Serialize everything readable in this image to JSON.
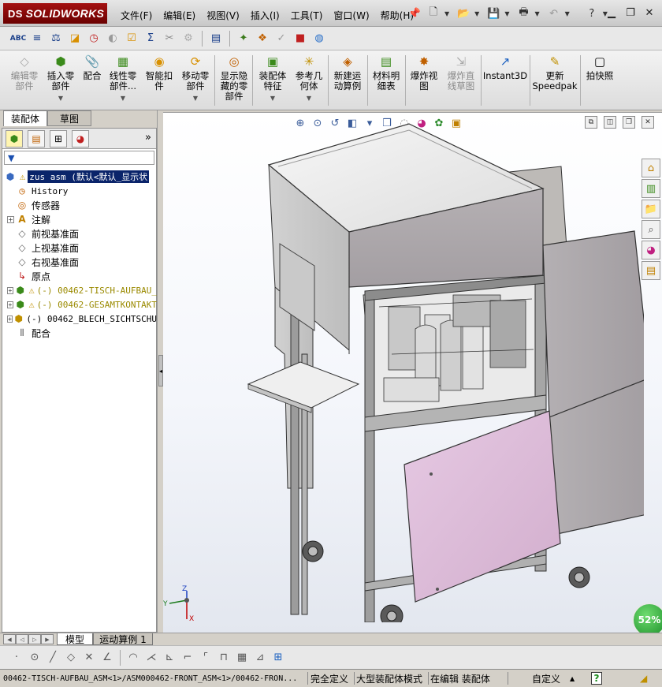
{
  "app": {
    "name": "SOLIDWORKS",
    "logo_prefix": "DS",
    "menu": [
      "文件(F)",
      "编辑(E)",
      "视图(V)",
      "插入(I)",
      "工具(T)",
      "窗口(W)",
      "帮助(H)"
    ],
    "title_icons": [
      "pin-icon",
      "new-icon",
      "open-icon",
      "save-icon",
      "print-icon",
      "undo-icon",
      "help-icon"
    ],
    "window_controls": [
      "minimize-icon",
      "restore-icon",
      "close-icon"
    ]
  },
  "sketch_toolbar": {
    "items": [
      "ABC",
      "≡",
      "⚖",
      "◪",
      "◷",
      "◐",
      "☑",
      "Σ",
      "✂",
      "⚙",
      "▤",
      "✦",
      "❖",
      "✓",
      "■",
      "◍"
    ]
  },
  "command_manager": {
    "items": [
      {
        "label_lines": [
          "编辑零",
          "部件"
        ],
        "dim": true,
        "dropdown": false,
        "icon": "◇"
      },
      {
        "label_lines": [
          "插入零",
          "部件"
        ],
        "dim": false,
        "dropdown": true,
        "icon": "⬢"
      },
      {
        "label_lines": [
          "配合"
        ],
        "dim": false,
        "dropdown": false,
        "icon": "📎"
      },
      {
        "label_lines": [
          "线性零",
          "部件..."
        ],
        "dim": false,
        "dropdown": true,
        "icon": "▦"
      },
      {
        "label_lines": [
          "智能扣",
          "件"
        ],
        "dim": false,
        "dropdown": false,
        "icon": "◉"
      },
      {
        "label_lines": [
          "移动零",
          "部件"
        ],
        "dim": false,
        "dropdown": true,
        "icon": "⟳"
      },
      {
        "label_lines": [
          "显示隐",
          "藏的零",
          "部件"
        ],
        "dim": false,
        "dropdown": false,
        "icon": "◎"
      },
      {
        "label_lines": [
          "装配体",
          "特征"
        ],
        "dim": false,
        "dropdown": true,
        "icon": "▣"
      },
      {
        "label_lines": [
          "参考几",
          "何体"
        ],
        "dim": false,
        "dropdown": true,
        "icon": "✳"
      },
      {
        "label_lines": [
          "新建运",
          "动算例"
        ],
        "dim": false,
        "dropdown": false,
        "icon": "◈"
      },
      {
        "label_lines": [
          "材料明",
          "细表"
        ],
        "dim": false,
        "dropdown": false,
        "icon": "▤"
      },
      {
        "label_lines": [
          "爆炸视",
          "图"
        ],
        "dim": false,
        "dropdown": false,
        "icon": "✸"
      },
      {
        "label_lines": [
          "爆炸直",
          "线草图"
        ],
        "dim": true,
        "dropdown": false,
        "icon": "⇲"
      },
      {
        "label_lines": [
          "Instant3D"
        ],
        "dim": false,
        "dropdown": false,
        "icon": "↗"
      },
      {
        "label_lines": [
          "更新",
          "Speedpak"
        ],
        "dim": false,
        "dropdown": false,
        "icon": "✎"
      },
      {
        "label_lines": [
          "拍快照"
        ],
        "dim": false,
        "dropdown": false,
        "icon": "▢"
      }
    ]
  },
  "left_tabs": {
    "assembly": "装配体",
    "sketch": "草图"
  },
  "feature_manager": {
    "tab_icons": [
      "feature-tree-icon",
      "property-icon",
      "config-icon",
      "display-icon"
    ],
    "more": "»",
    "filter_icon": "▼",
    "tree": [
      {
        "text": "zus asm  (默认<默认_显示状",
        "icon": "assembly-icon",
        "warn": true,
        "expand": false,
        "selected": true,
        "mono": true,
        "olive": false
      },
      {
        "text": "History",
        "icon": "history-icon",
        "warn": false,
        "expand": false,
        "mono": true,
        "olive": false
      },
      {
        "text": "传感器",
        "icon": "sensor-icon",
        "warn": false,
        "expand": false,
        "mono": false,
        "olive": false
      },
      {
        "text": "注解",
        "icon": "annotation-icon",
        "warn": false,
        "expand": true,
        "mono": false,
        "olive": false
      },
      {
        "text": "前视基准面",
        "icon": "plane-icon",
        "warn": false,
        "expand": false,
        "mono": false,
        "olive": false
      },
      {
        "text": "上视基准面",
        "icon": "plane-icon",
        "warn": false,
        "expand": false,
        "mono": false,
        "olive": false
      },
      {
        "text": "右视基准面",
        "icon": "plane-icon",
        "warn": false,
        "expand": false,
        "mono": false,
        "olive": false
      },
      {
        "text": "原点",
        "icon": "origin-icon",
        "warn": false,
        "expand": false,
        "mono": false,
        "olive": false
      },
      {
        "text": "(-) 00462-TISCH-AUFBAU_",
        "icon": "subassembly-icon",
        "warn": true,
        "expand": true,
        "mono": true,
        "olive": true
      },
      {
        "text": "(-) 00462-GESAMTKONTAKT",
        "icon": "subassembly-icon",
        "warn": true,
        "expand": true,
        "mono": true,
        "olive": true
      },
      {
        "text": "(-) 00462_BLECH_SICHTSCHU",
        "icon": "subassembly-icon",
        "warn": false,
        "expand": true,
        "mono": true,
        "olive": false
      },
      {
        "text": "配合",
        "icon": "mates-icon",
        "warn": false,
        "expand": false,
        "mono": false,
        "olive": false
      }
    ]
  },
  "viewport": {
    "hud_icons": [
      "zoom-fit-icon",
      "zoom-area-icon",
      "previous-view-icon",
      "section-view-icon",
      "view-orientation-icon",
      "display-style-icon",
      "hide-show-icon",
      "appearance-icon",
      "scene-icon",
      "view-settings-icon"
    ],
    "zoom_percent": "52%",
    "triad": {
      "x": "X",
      "y": "Y",
      "z": "Z"
    }
  },
  "bottom_tabs": {
    "model": "模型",
    "motion": "运动算例 1"
  },
  "status_bar": {
    "path": "00462-TISCH-AUFBAU_ASM<1>/ASM000462-FRONT_ASM<1>/00462-FRON...",
    "fully_defined": "完全定义",
    "large_assembly": "大型装配体模式",
    "editing": "在编辑 装配体",
    "custom": "自定义",
    "help": "?"
  }
}
